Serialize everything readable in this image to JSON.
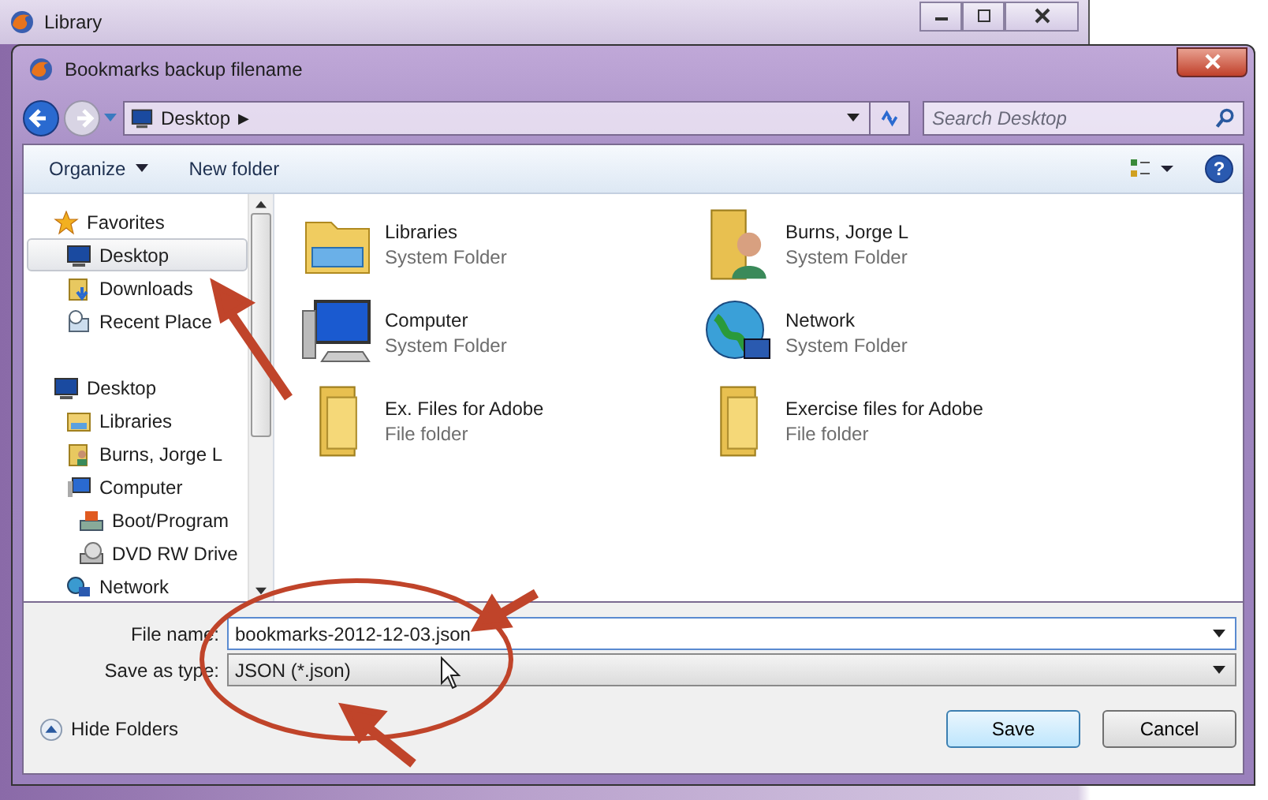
{
  "back_window": {
    "title": "Library"
  },
  "dialog": {
    "title": "Bookmarks backup filename"
  },
  "address": {
    "location": "Desktop",
    "separator": "▶"
  },
  "search": {
    "placeholder": "Search Desktop"
  },
  "toolbar": {
    "organize": "Organize",
    "new_folder": "New folder",
    "help": "?"
  },
  "sidebar": {
    "items": [
      {
        "label": "Favorites",
        "kind": "star",
        "selected": false,
        "children": [
          {
            "label": "Desktop",
            "kind": "desktop",
            "selected": true
          },
          {
            "label": "Downloads",
            "kind": "download",
            "selected": false
          },
          {
            "label": "Recent Place",
            "kind": "recent",
            "selected": false
          }
        ]
      },
      {
        "label": "Desktop",
        "kind": "desktop",
        "selected": false,
        "children": [
          {
            "label": "Libraries",
            "kind": "library",
            "selected": false
          },
          {
            "label": "Burns, Jorge L",
            "kind": "user",
            "selected": false
          },
          {
            "label": "Computer",
            "kind": "computer",
            "selected": false,
            "children": [
              {
                "label": "Boot/Program",
                "kind": "drive",
                "selected": false
              },
              {
                "label": "DVD RW Drive",
                "kind": "dvd",
                "selected": false
              }
            ]
          },
          {
            "label": "Network",
            "kind": "network",
            "selected": false
          }
        ]
      }
    ]
  },
  "files": [
    {
      "name": "Libraries",
      "type": "System Folder",
      "kind": "library"
    },
    {
      "name": "Burns, Jorge L",
      "type": "System Folder",
      "kind": "user"
    },
    {
      "name": "Computer",
      "type": "System Folder",
      "kind": "computer"
    },
    {
      "name": "Network",
      "type": "System Folder",
      "kind": "network"
    },
    {
      "name": "Ex. Files for Adobe",
      "type": "File folder",
      "kind": "folder"
    },
    {
      "name": "Exercise files for Adobe",
      "type": "File folder",
      "kind": "folder"
    }
  ],
  "form": {
    "file_name_label": "File name:",
    "file_name": "bookmarks-2012-12-03.json",
    "type_label": "Save as type:",
    "type": "JSON (*.json)"
  },
  "footer": {
    "hide_folders": "Hide Folders",
    "save": "Save",
    "cancel": "Cancel"
  }
}
